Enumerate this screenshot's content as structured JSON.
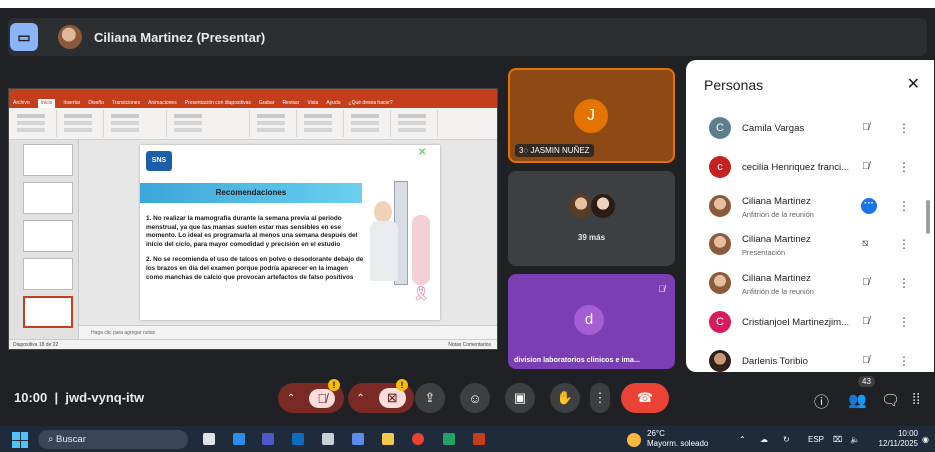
{
  "presenter_bar": {
    "title": "Ciliana Martinez (Presentar)"
  },
  "presentation": {
    "slide_title": "Recomendaciones",
    "logo_text": "SNS",
    "paragraph_1": "1. No realizar la mamografía durante la semana previa al periodo menstrual, ya que las mamas suelen estar mas sensibles en ese momento. Lo ideal es programarla al menos una semana después del inicio del ciclo, para mayor comodidad y precisión en el estudio",
    "paragraph_2": "2. No se recomienda el uso de talcos en polvo o desodorante debajo de los brazos en día del examen porque podría aparecer en la imagen como manchas de calcio que provocan artefactos de falso positivos",
    "notes_placeholder": "Haga clic para agregar notas",
    "ribbon_tabs": [
      "Archivo",
      "Inicio",
      "Insertar",
      "Diseño",
      "Transiciones",
      "Animaciones",
      "Presentación con diapositivas",
      "Grabar",
      "Revisar",
      "Vista",
      "Ayuda",
      "¿Qué desea hacer?"
    ],
    "status_left": "Diapositiva 18 de 22",
    "status_right": "Notas   Comentarios"
  },
  "tiles": {
    "jasmin": {
      "initial": "J",
      "name": "JASMIN NUÑEZ"
    },
    "more": {
      "label": "39 más"
    },
    "division": {
      "initial": "d",
      "name": "division laboratorios clinicos e ima..."
    }
  },
  "people": {
    "title": "Personas",
    "list": [
      {
        "initial": "C",
        "name": "Camila Vargas",
        "role": "",
        "color": "#5f7e8c"
      },
      {
        "initial": "c",
        "name": "cecilia Henriquez franci...",
        "role": "",
        "color": "#c5221f"
      },
      {
        "initial": "",
        "name": "Ciliana Martinez",
        "role": "Anfitrión de la reunión",
        "color": "#a07050"
      },
      {
        "initial": "",
        "name": "Ciliana Martinez",
        "role": "Presentación",
        "color": "#a07050"
      },
      {
        "initial": "",
        "name": "Ciliana Martinez",
        "role": "Anfitrión de la reunión",
        "color": "#a07050"
      },
      {
        "initial": "C",
        "name": "Cristianjoel Martinezjim...",
        "role": "",
        "color": "#d81b60"
      },
      {
        "initial": "",
        "name": "Darlenis Toribio",
        "role": "",
        "color": "#4a3a30"
      }
    ]
  },
  "control_bar": {
    "time": "10:00",
    "meeting_code": "jwd-vynq-itw",
    "participant_count": "43"
  },
  "taskbar": {
    "search_placeholder": "Buscar",
    "temperature": "26°C",
    "weather_text": "Mayorm. soleado",
    "language": "ESP",
    "clock_time": "10:00",
    "clock_date": "12/11/2025"
  }
}
